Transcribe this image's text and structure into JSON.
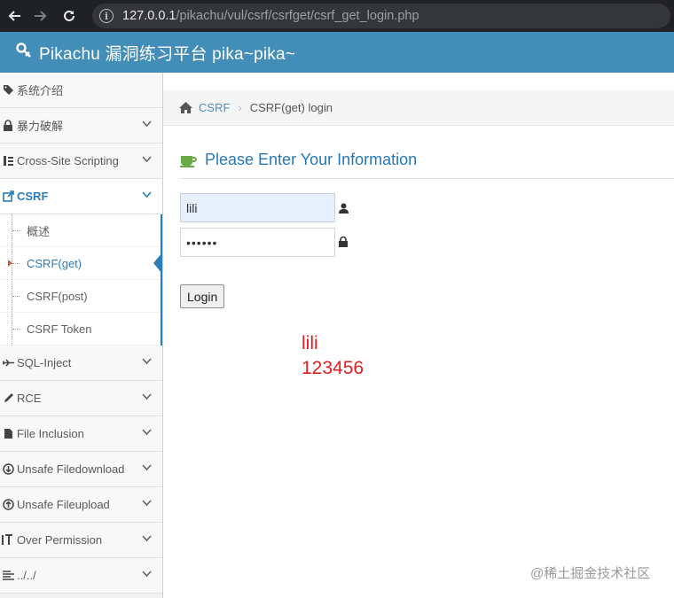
{
  "browser": {
    "url_host": "127.0.0.1",
    "url_path": "/pikachu/vul/csrf/csrfget/csrf_get_login.php"
  },
  "header": {
    "brand": "Pikachu 漏洞练习平台 pika~pika~",
    "bg_color": "#438eb9"
  },
  "sidebar": {
    "items": [
      {
        "label": "系统介绍",
        "icon": "tags-icon"
      },
      {
        "label": "暴力破解",
        "icon": "lock-icon"
      },
      {
        "label": "Cross-Site Scripting",
        "icon": "sitemap-icon"
      },
      {
        "label": "CSRF",
        "icon": "external-link-icon"
      },
      {
        "label": "SQL-Inject",
        "icon": "fighter-jet-icon"
      },
      {
        "label": "RCE",
        "icon": "pencil-icon"
      },
      {
        "label": "File Inclusion",
        "icon": "file-icon"
      },
      {
        "label": "Unsafe Filedownload",
        "icon": "download-icon"
      },
      {
        "label": "Unsafe Fileupload",
        "icon": "upload-icon"
      },
      {
        "label": "Over Permission",
        "icon": "text-height-icon"
      },
      {
        "label": "../../",
        "icon": "align-left-icon"
      }
    ],
    "csrf_sub": [
      {
        "label": "概述"
      },
      {
        "label": "CSRF(get)"
      },
      {
        "label": "CSRF(post)"
      },
      {
        "label": "CSRF Token"
      }
    ]
  },
  "breadcrumb": {
    "link": "CSRF",
    "current": "CSRF(get) login"
  },
  "form": {
    "title": "Please Enter Your Information",
    "username_value": "lili",
    "password_value": "••••••",
    "login_label": "Login"
  },
  "note": {
    "line1": "lili",
    "line2": "123456"
  },
  "watermark": "@稀土掘金技术社区"
}
